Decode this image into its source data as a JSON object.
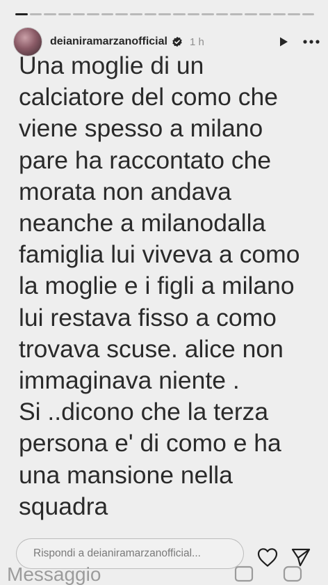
{
  "progress": {
    "segments": 21,
    "active_index": 0
  },
  "header": {
    "username": "deianiramarzanofficial",
    "time": "1 h",
    "icons": [
      "verified-badge-icon",
      "play-icon",
      "more-icon"
    ]
  },
  "story": {
    "text": "Una moglie di un\ncalciatore del como che\nviene spesso a milano\npare ha raccontato che\nmorata non andava\nneanche a milanodalla\nfamiglia lui viveva a como\nla moglie e i figli a milano\nlui  restava fisso a como\ntrovava scuse. alice non\nimmaginava niente .\nSi ..dicono che la terza\npersona e' di como e ha\nuna mansione nella\nsquadra"
  },
  "footer": {
    "reply_placeholder": "Rispondi a deianiramarzanofficial...",
    "ghost_text": "Messaggio",
    "icons": [
      "heart-icon",
      "send-icon"
    ]
  }
}
